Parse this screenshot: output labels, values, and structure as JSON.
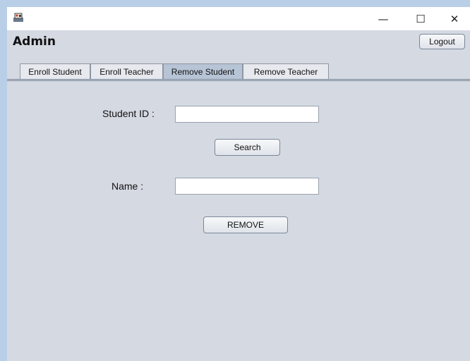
{
  "window": {
    "title": "",
    "minimize_glyph": "—",
    "maximize_glyph": "☐",
    "close_glyph": "✕"
  },
  "header": {
    "title": "Admin",
    "logout_label": "Logout"
  },
  "tabs": [
    {
      "label": "Enroll Student",
      "active": false
    },
    {
      "label": "Enroll Teacher",
      "active": false
    },
    {
      "label": "Remove Student",
      "active": true
    },
    {
      "label": "Remove Teacher",
      "active": false
    }
  ],
  "form": {
    "student_id_label": "Student ID :",
    "student_id_value": "",
    "search_label": "Search",
    "name_label": "Name :",
    "name_value": "",
    "remove_label": "REMOVE"
  }
}
